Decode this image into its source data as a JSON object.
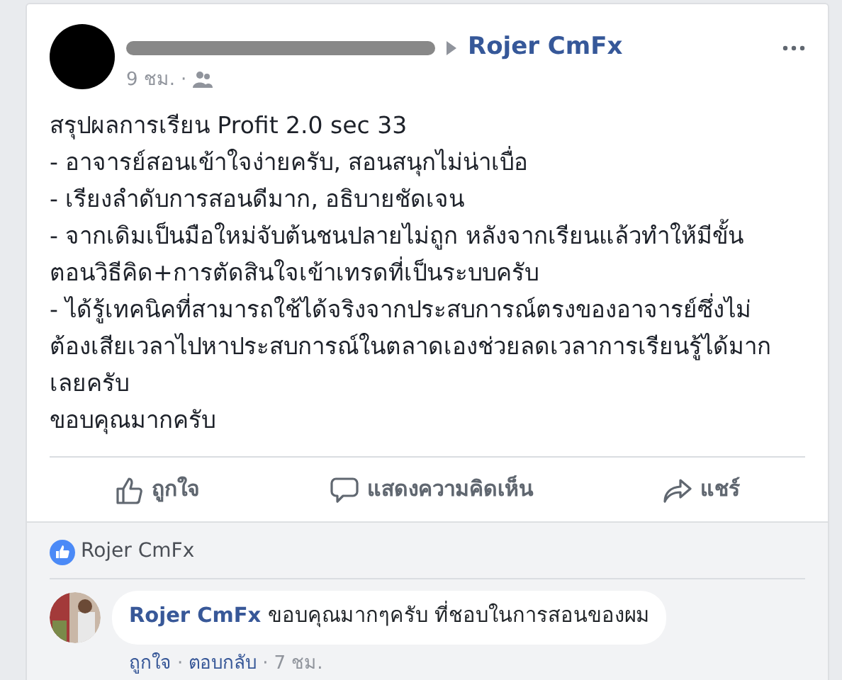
{
  "post": {
    "author": {
      "redacted": true
    },
    "target": "Rojer CmFx",
    "time": "9 ชม.",
    "separator": "·",
    "lines": [
      "สรุปผลการเรียน Profit 2.0 sec 33",
      "- อาจารย์สอนเข้าใจง่ายครับ, สอนสนุกไม่น่าเบื่อ",
      "- เรียงลำดับการสอนดีมาก, อธิบายชัดเจน",
      "- จากเดิมเป็นมือใหม่จับต้นชนปลายไม่ถูก หลังจากเรียนแล้วทำให้มีขั้น",
      "ตอนวิธีคิด+การตัดสินใจเข้าเทรดที่เป็นระบบครับ",
      "- ได้รู้เทคนิคที่สามารถใช้ได้จริงจากประสบการณ์ตรงของอาจารย์ซึ่งไม่",
      "ต้องเสียเวลาไปหาประสบการณ์ในตลาดเองช่วยลดเวลาการเรียนรู้ได้มาก",
      "เลยครับ",
      "ขอบคุณมากครับ"
    ]
  },
  "actions": [
    {
      "kind": "like",
      "label": "ถูกใจ"
    },
    {
      "kind": "comment",
      "label": "แสดงความคิดเห็น"
    },
    {
      "kind": "share",
      "label": "แชร์"
    }
  ],
  "likes": {
    "names": "Rojer CmFx"
  },
  "comments": [
    {
      "author": "Rojer CmFx",
      "text": "ขอบคุณมากๆครับ ที่ชอบในการสอนของผม",
      "actions": [
        "ถูกใจ",
        "ตอบกลับ"
      ],
      "separator": "·",
      "time": "7 ชม."
    }
  ]
}
